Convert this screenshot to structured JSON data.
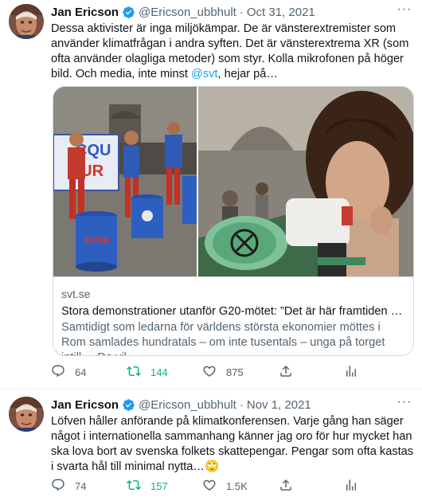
{
  "tweets": [
    {
      "author": {
        "name": "Jan Ericson",
        "handle": "@Ericson_ubbhult",
        "verified": true
      },
      "date": "Oct 31, 2021",
      "text_before": "Dessa aktivister är inga miljökämpar. De är vänsterextremister som använder klimatfrågan i andra syften. Det är vänsterextrema XR (som ofta använder olagliga metoder) som styr. Kolla mikrofonen på höger bild. Och media, inte minst ",
      "mention": "@svt",
      "text_after": ", hejar på…",
      "card": {
        "domain": "svt.se",
        "title": "Stora demonstrationer utanför G20-mötet: ”Det är här framtiden skap…",
        "description": "Samtidigt som ledarna för världens största ekonomier möttes i Rom samlades hundratals – om inte tusentals – unga på torget intill. – De vil…",
        "left_banner_text": "CQU\nTUR",
        "barrel_text": "PUSH"
      },
      "stats": {
        "replies": "64",
        "retweets": "144",
        "likes": "875"
      }
    },
    {
      "author": {
        "name": "Jan Ericson",
        "handle": "@Ericson_ubbhult",
        "verified": true
      },
      "date": "Nov 1, 2021",
      "text": "Löfven håller anförande på klimatkonferensen. Varje gång han säger något i internationella sammanhang känner jag oro för hur mycket han ska lova bort av svenska folkets skattepengar. Pengar som ofta kastas i svarta hål till minimal nytta…🙄",
      "stats": {
        "replies": "74",
        "retweets": "157",
        "likes": "1.5K"
      }
    }
  ],
  "colors": {
    "accent": "#1d9bf0",
    "retweet": "#00ba7c",
    "secondary_text": "#536471",
    "border": "#cfd9de"
  },
  "icons": [
    "verified-badge-icon",
    "more-icon",
    "reply-icon",
    "retweet-icon",
    "like-icon",
    "share-icon",
    "analytics-icon"
  ]
}
